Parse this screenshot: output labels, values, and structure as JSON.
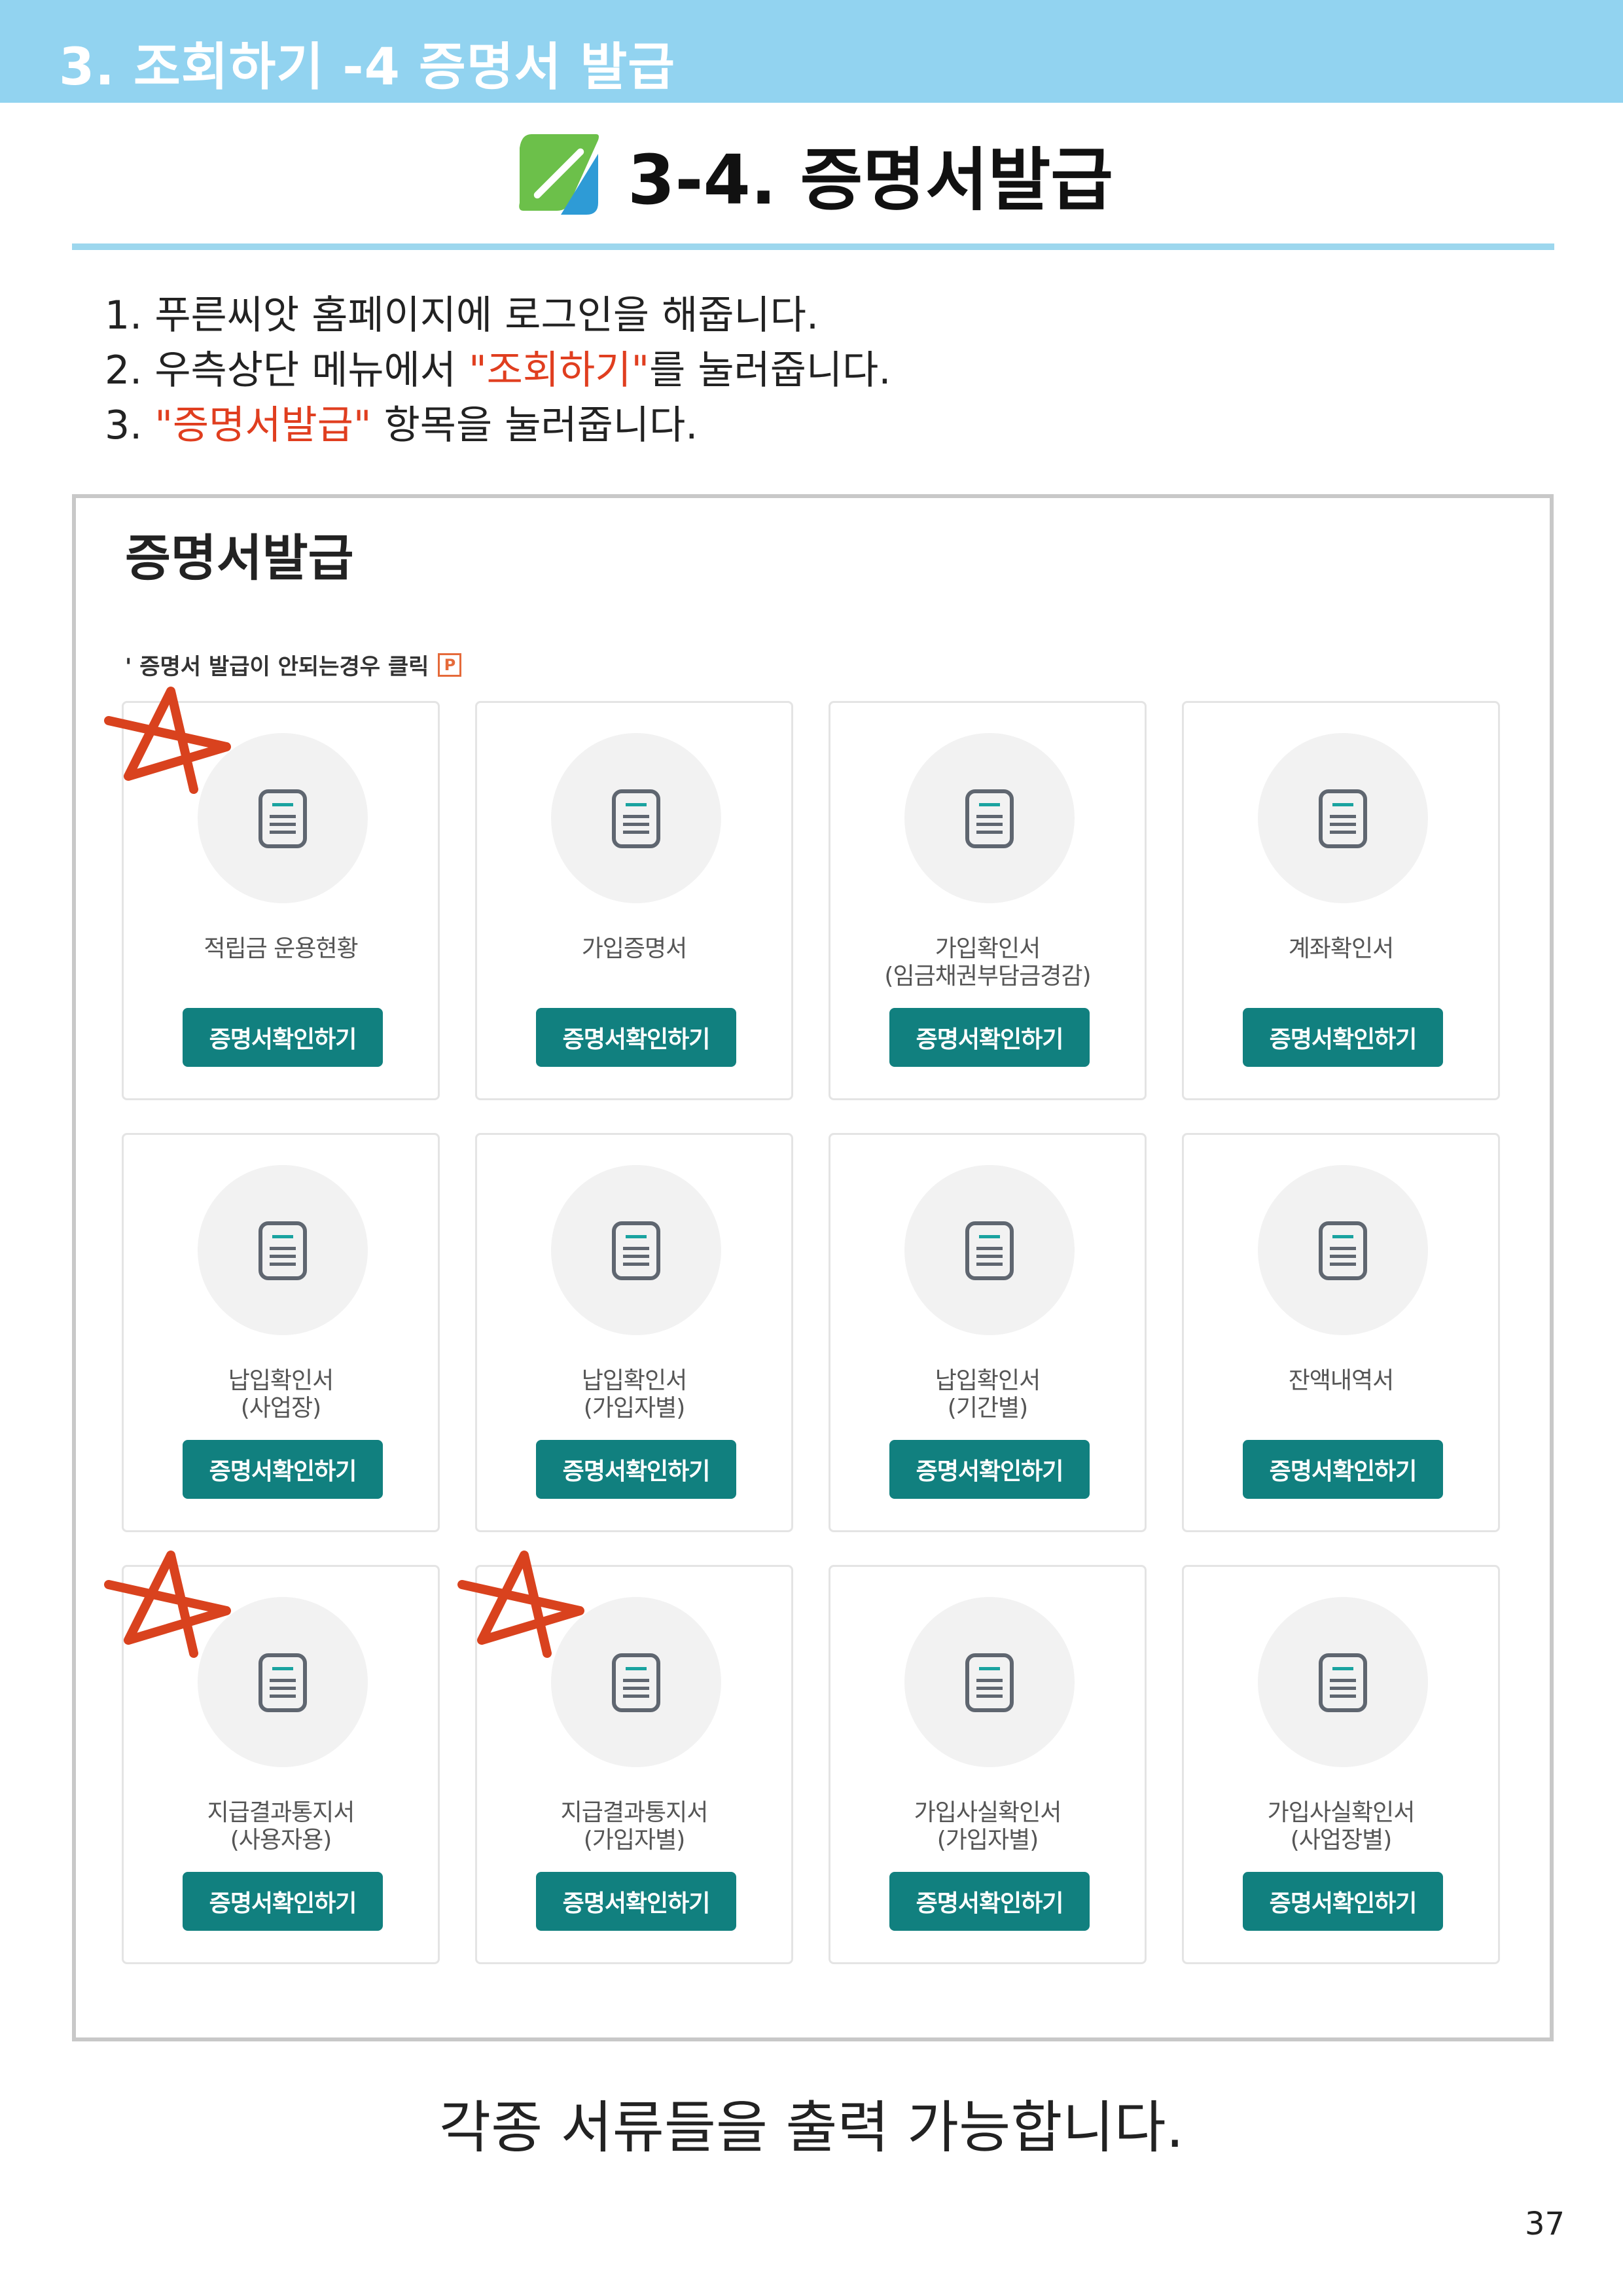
{
  "header": {
    "section_title": "3. 조회하기 -4 증명서 발급"
  },
  "title": {
    "text": "3-4. 증명서발급",
    "logo_icon": "leaf-logo-icon",
    "logo_colors": [
      "#6cc04a",
      "#2e9bd6"
    ]
  },
  "steps": [
    {
      "num": "1.",
      "pre": "푸른씨앗 홈페이지에 로그인을 해줍니다.",
      "highlight": "",
      "post": ""
    },
    {
      "num": "2.",
      "pre": "우측상단 메뉴에서 ",
      "highlight": "\"조회하기\"",
      "post": "를 눌러줍니다."
    },
    {
      "num": "3.",
      "pre": "",
      "highlight": "\"증명서발급\"",
      "post": " 항목을 눌러줍니다."
    }
  ],
  "screenshot": {
    "title": "증명서발급",
    "notice": "' 증명서 발급이 안되는경우 클릭",
    "notice_icon_letter": "P",
    "button_label": "증명서확인하기",
    "button_color": "#11807f",
    "cards": [
      {
        "line1": "적립금 운용현황",
        "line2": "",
        "starred": true
      },
      {
        "line1": "가입증명서",
        "line2": "",
        "starred": false
      },
      {
        "line1": "가입확인서",
        "line2": "(임금채권부담금경감)",
        "starred": false
      },
      {
        "line1": "계좌확인서",
        "line2": "",
        "starred": false
      },
      {
        "line1": "납입확인서",
        "line2": "(사업장)",
        "starred": false
      },
      {
        "line1": "납입확인서",
        "line2": "(가입자별)",
        "starred": false
      },
      {
        "line1": "납입확인서",
        "line2": "(기간별)",
        "starred": false
      },
      {
        "line1": "잔액내역서",
        "line2": "",
        "starred": false
      },
      {
        "line1": "지급결과통지서",
        "line2": "(사용자용)",
        "starred": true
      },
      {
        "line1": "지급결과통지서",
        "line2": "(가입자별)",
        "starred": true
      },
      {
        "line1": "가입사실확인서",
        "line2": "(가입자별)",
        "starred": false
      },
      {
        "line1": "가입사실확인서",
        "line2": "(사업장별)",
        "starred": false
      }
    ]
  },
  "caption": "각종 서류들을 출력 가능합니다.",
  "page_number": "37",
  "colors": {
    "header_band": "#92d3f0",
    "highlight": "#e03e1f",
    "star": "#d9421e"
  }
}
